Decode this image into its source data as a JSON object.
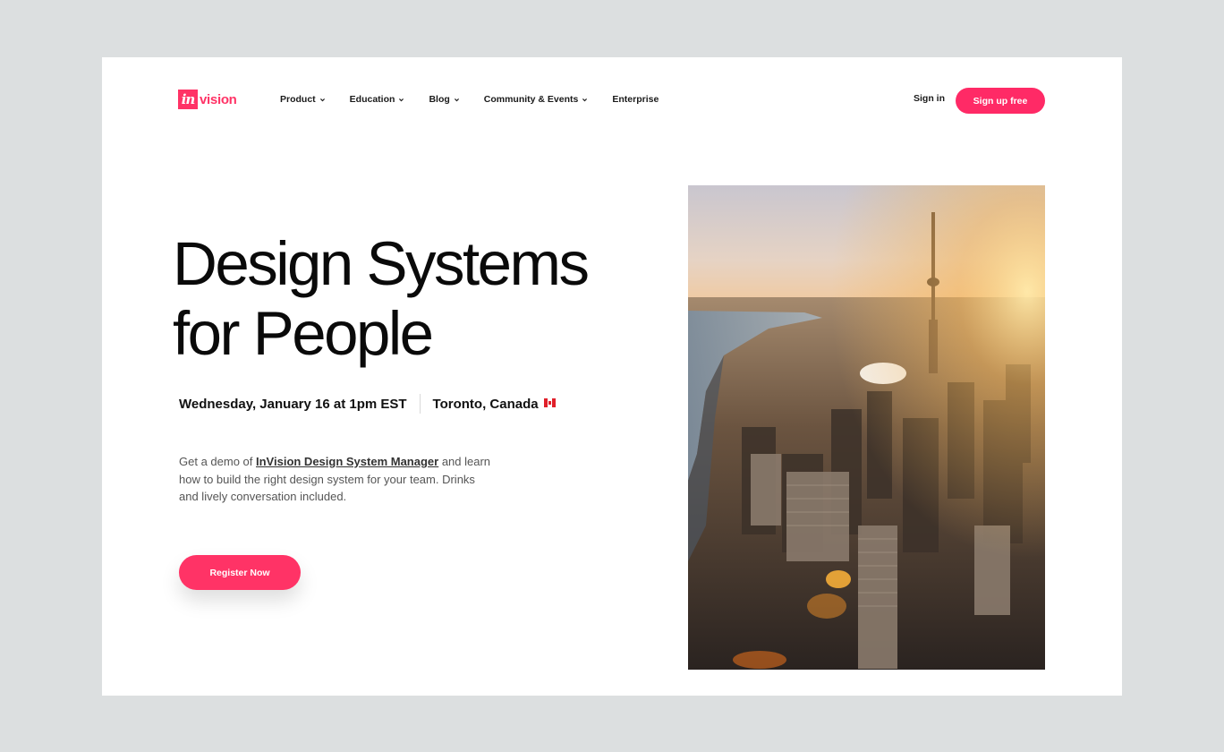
{
  "brand": {
    "logo_mark": "in",
    "logo_word": "vision",
    "accent": "#ff3366"
  },
  "nav": {
    "items": [
      {
        "label": "Product",
        "has_dropdown": true
      },
      {
        "label": "Education",
        "has_dropdown": true
      },
      {
        "label": "Blog",
        "has_dropdown": true
      },
      {
        "label": "Community & Events",
        "has_dropdown": true
      },
      {
        "label": "Enterprise",
        "has_dropdown": false
      }
    ],
    "sign_in": "Sign in",
    "sign_up": "Sign up free"
  },
  "hero": {
    "title_line1": "Design Systems",
    "title_line2": "for People",
    "date": "Wednesday, January 16 at 1pm EST",
    "location": "Toronto, Canada",
    "location_flag_icon": "canada-flag-icon",
    "description_before": "Get a demo of ",
    "description_link": "InVision Design System Manager",
    "description_after": " and learn how to build the right design system for your team. Drinks and lively conversation included.",
    "cta": "Register Now"
  },
  "image": {
    "subject": "city-aerial-photo"
  }
}
